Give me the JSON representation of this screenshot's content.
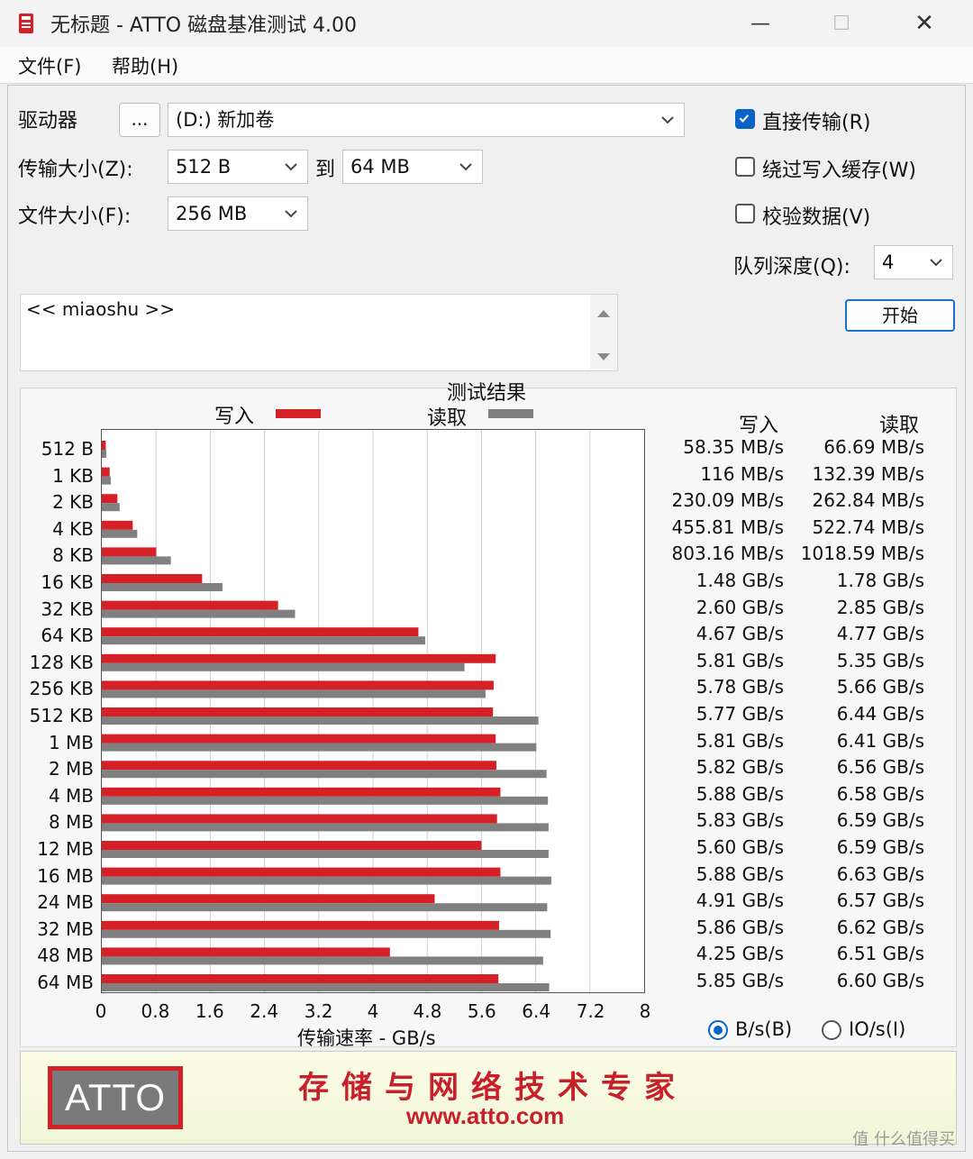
{
  "window": {
    "title": "无标题 - ATTO 磁盘基准测试 4.00",
    "minimize": "—",
    "maximize": "☐",
    "close": "✕"
  },
  "menu": {
    "file": "文件(F)",
    "help": "帮助(H)"
  },
  "settings": {
    "drive_label": "驱动器",
    "browse_label": "...",
    "drive_value": "(D:) 新加卷",
    "transfer_label": "传输大小(Z):",
    "transfer_from": "512 B",
    "to_label": "到",
    "transfer_to": "64 MB",
    "filesize_label": "文件大小(F):",
    "filesize_value": "256 MB",
    "direct_io_label": "直接传输(R)",
    "direct_io_checked": true,
    "bypass_cache_label": "绕过写入缓存(W)",
    "bypass_cache_checked": false,
    "verify_label": "校验数据(V)",
    "verify_checked": false,
    "queue_label": "队列深度(Q):",
    "queue_value": "4",
    "start_label": "开始"
  },
  "description": {
    "text": "<< miaoshu >>"
  },
  "results": {
    "title": "测试结果",
    "legend_write": "写入",
    "legend_read": "读取",
    "write_header": "写入",
    "read_header": "读取",
    "unit_bs": "B/s(B)",
    "unit_ios": "IO/s(I)",
    "unit_bs_selected": true
  },
  "chart_data": {
    "type": "bar",
    "orientation": "horizontal",
    "categories": [
      "512 B",
      "1 KB",
      "2 KB",
      "4 KB",
      "8 KB",
      "16 KB",
      "32 KB",
      "64 KB",
      "128 KB",
      "256 KB",
      "512 KB",
      "1 MB",
      "2 MB",
      "4 MB",
      "8 MB",
      "12 MB",
      "16 MB",
      "24 MB",
      "32 MB",
      "48 MB",
      "64 MB"
    ],
    "series": [
      {
        "name": "写入",
        "color": "#d52027",
        "values": [
          0.05835,
          0.116,
          0.23009,
          0.45581,
          0.80316,
          1.48,
          2.6,
          4.67,
          5.81,
          5.78,
          5.77,
          5.81,
          5.82,
          5.88,
          5.83,
          5.6,
          5.88,
          4.91,
          5.86,
          4.25,
          5.85
        ]
      },
      {
        "name": "读取",
        "color": "#808080",
        "values": [
          0.06669,
          0.13239,
          0.26284,
          0.52274,
          1.01859,
          1.78,
          2.85,
          4.77,
          5.35,
          5.66,
          6.44,
          6.41,
          6.56,
          6.58,
          6.59,
          6.59,
          6.63,
          6.57,
          6.62,
          6.51,
          6.6
        ]
      }
    ],
    "xlabel": "传输速率 - GB/s",
    "xlim": [
      0,
      8
    ],
    "xticks": [
      "0",
      "0.8",
      "1.6",
      "2.4",
      "3.2",
      "4",
      "4.8",
      "5.6",
      "6.4",
      "7.2",
      "8"
    ],
    "grid": true,
    "legend": "top"
  },
  "write_values": [
    "58.35 MB/s",
    "116 MB/s",
    "230.09 MB/s",
    "455.81 MB/s",
    "803.16 MB/s",
    "1.48 GB/s",
    "2.60 GB/s",
    "4.67 GB/s",
    "5.81 GB/s",
    "5.78 GB/s",
    "5.77 GB/s",
    "5.81 GB/s",
    "5.82 GB/s",
    "5.88 GB/s",
    "5.83 GB/s",
    "5.60 GB/s",
    "5.88 GB/s",
    "4.91 GB/s",
    "5.86 GB/s",
    "4.25 GB/s",
    "5.85 GB/s"
  ],
  "read_values": [
    "66.69 MB/s",
    "132.39 MB/s",
    "262.84 MB/s",
    "522.74 MB/s",
    "1018.59 MB/s",
    "1.78 GB/s",
    "2.85 GB/s",
    "4.77 GB/s",
    "5.35 GB/s",
    "5.66 GB/s",
    "6.44 GB/s",
    "6.41 GB/s",
    "6.56 GB/s",
    "6.58 GB/s",
    "6.59 GB/s",
    "6.59 GB/s",
    "6.63 GB/s",
    "6.57 GB/s",
    "6.62 GB/s",
    "6.51 GB/s",
    "6.60 GB/s"
  ],
  "banner": {
    "logo": "ATTO",
    "slogan": "存储与网络技术专家",
    "url": "www.atto.com"
  },
  "watermark": "值 什么值得买"
}
